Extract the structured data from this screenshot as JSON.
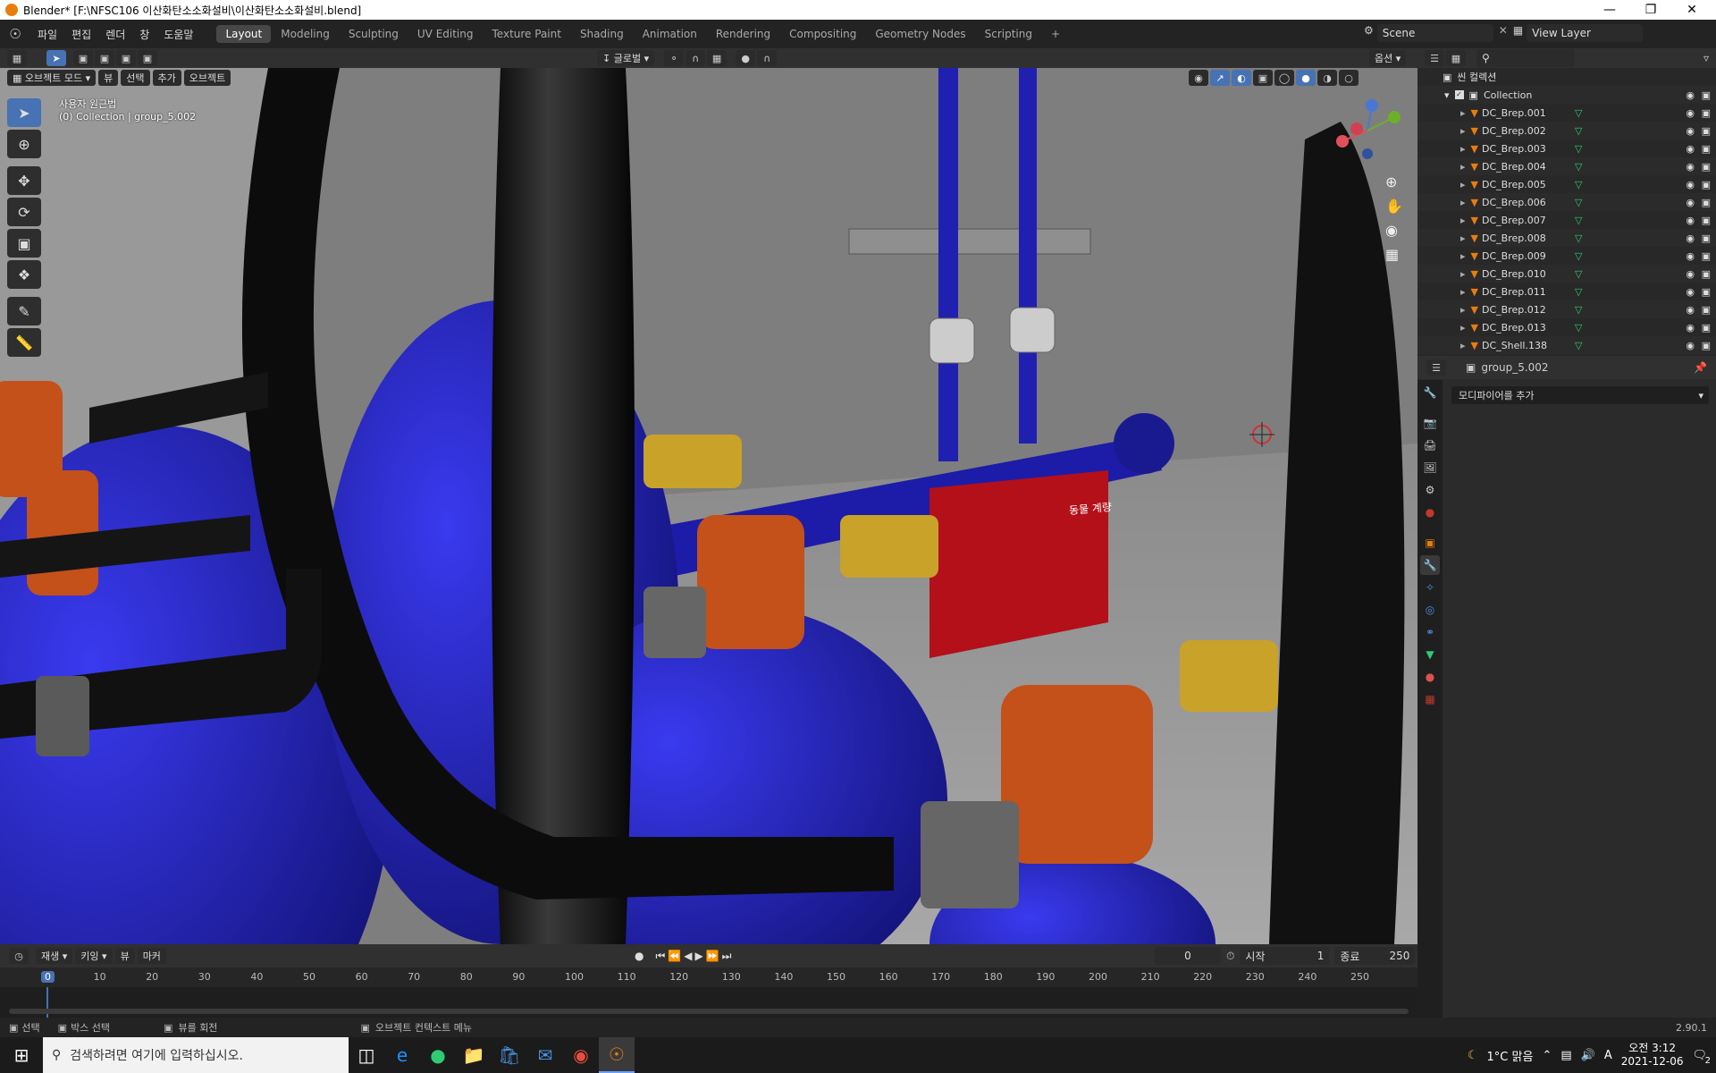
{
  "window": {
    "title": "Blender* [F:\\NFSC106 이산화탄소소화설비\\이산화탄소소화설비.blend]"
  },
  "menus": [
    "파일",
    "편집",
    "렌더",
    "창",
    "도움말"
  ],
  "workspaces": [
    "Layout",
    "Modeling",
    "Sculpting",
    "UV Editing",
    "Texture Paint",
    "Shading",
    "Animation",
    "Rendering",
    "Compositing",
    "Geometry Nodes",
    "Scripting"
  ],
  "active_workspace": "Layout",
  "scene": {
    "name": "Scene",
    "view_layer": "View Layer"
  },
  "viewport_header": {
    "mode": "오브젝트 모드",
    "menu": [
      "뷰",
      "선택",
      "추가",
      "오브젝트"
    ],
    "transform": "글로벌",
    "options": "옵션"
  },
  "viewport": {
    "view_name": "사용자 원근법",
    "collection_info": "(0) Collection | group_5.002",
    "panel_label": "동물 계량"
  },
  "outliner": {
    "root": "씬 컬렉션",
    "collection": "Collection",
    "items": [
      "DC_Brep.001",
      "DC_Brep.002",
      "DC_Brep.003",
      "DC_Brep.004",
      "DC_Brep.005",
      "DC_Brep.006",
      "DC_Brep.007",
      "DC_Brep.008",
      "DC_Brep.009",
      "DC_Brep.010",
      "DC_Brep.011",
      "DC_Brep.012",
      "DC_Brep.013",
      "DC_Shell.138"
    ]
  },
  "properties": {
    "object_name": "group_5.002",
    "add_modifier": "모디파이어를 추가"
  },
  "timeline": {
    "menu": [
      "재생",
      "키잉",
      "뷰",
      "마커"
    ],
    "current_frame": "0",
    "start_label": "시작",
    "start": "1",
    "end_label": "종료",
    "end": "250",
    "ticks": [
      "0",
      "10",
      "20",
      "30",
      "40",
      "50",
      "60",
      "70",
      "80",
      "90",
      "100",
      "110",
      "120",
      "130",
      "140",
      "150",
      "160",
      "170",
      "180",
      "190",
      "200",
      "210",
      "220",
      "230",
      "240",
      "250"
    ]
  },
  "statusbar": {
    "select": "선택",
    "box_select": "박스 선택",
    "rotate_view": "뷰를 회전",
    "context_menu": "오브젝트 컨텍스트 메뉴",
    "version": "2.90.1"
  },
  "taskbar": {
    "search_placeholder": "검색하려면 여기에 입력하십시오.",
    "weather": "1°C 맑음",
    "time": "오전 3:12",
    "date": "2021-12-06",
    "notifications": "2",
    "ime": "A"
  },
  "colors": {
    "accent": "#4772b3",
    "brand": "#e87d0d",
    "pipe_blue": "#1f1fa8",
    "valve_orange": "#c4501a",
    "brass": "#c9a22a",
    "panel_red": "#b3101a"
  }
}
